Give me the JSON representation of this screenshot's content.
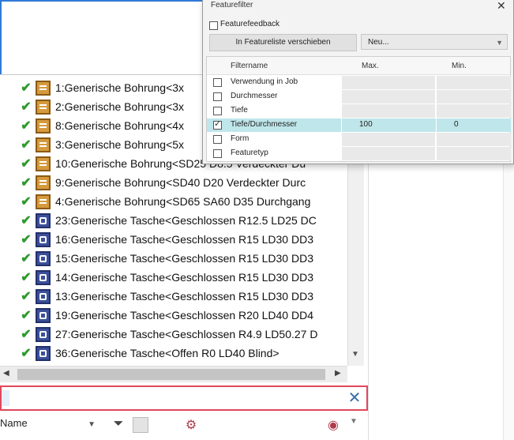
{
  "tree": {
    "items": [
      {
        "label": "1:Generische Bohrung<3x",
        "type": "bore"
      },
      {
        "label": "2:Generische Bohrung<3x",
        "type": "bore"
      },
      {
        "label": "8:Generische Bohrung<4x",
        "type": "bore"
      },
      {
        "label": "3:Generische Bohrung<5x",
        "type": "bore"
      },
      {
        "label": "10:Generische Bohrung<SD25 D8.5 Verdeckter Du",
        "type": "bore"
      },
      {
        "label": "9:Generische Bohrung<SD40 D20 Verdeckter Durc",
        "type": "bore"
      },
      {
        "label": "4:Generische Bohrung<SD65 SA60 D35 Durchgang",
        "type": "bore"
      },
      {
        "label": "23:Generische Tasche<Geschlossen R12.5 LD25 DC",
        "type": "pocket"
      },
      {
        "label": "16:Generische Tasche<Geschlossen R15 LD30 DD3",
        "type": "pocket"
      },
      {
        "label": "15:Generische Tasche<Geschlossen R15 LD30 DD3",
        "type": "pocket"
      },
      {
        "label": "14:Generische Tasche<Geschlossen R15 LD30 DD3",
        "type": "pocket"
      },
      {
        "label": "13:Generische Tasche<Geschlossen R15 LD30 DD3",
        "type": "pocket"
      },
      {
        "label": "19:Generische Tasche<Geschlossen R20 LD40 DD4",
        "type": "pocket"
      },
      {
        "label": "27:Generische Tasche<Geschlossen R4.9 LD50.27 D",
        "type": "pocket"
      },
      {
        "label": "36:Generische Tasche<Offen R0 LD40 Blind>",
        "type": "pocket"
      }
    ]
  },
  "filter": {
    "value": "",
    "placeholder": ""
  },
  "bottombar": {
    "sort_label": "Name"
  },
  "popup": {
    "title": "Featurefilter",
    "featurefeedback_label": "Featurefeedback",
    "move_button_label": "In Featureliste verschieben",
    "combo_value": "Neu...",
    "columns": {
      "name": "Filtername",
      "max": "Max.",
      "min": "Min."
    },
    "rows": [
      {
        "label": "Verwendung in Job",
        "checked": false,
        "max": "",
        "min": "",
        "selected": false
      },
      {
        "label": "Durchmesser",
        "checked": false,
        "max": "",
        "min": "",
        "selected": false
      },
      {
        "label": "Tiefe",
        "checked": false,
        "max": "",
        "min": "",
        "selected": false
      },
      {
        "label": "Tiefe/Durchmesser",
        "checked": true,
        "max": "100",
        "min": "0",
        "selected": true
      },
      {
        "label": "Form",
        "checked": false,
        "max": "",
        "min": "",
        "selected": false
      },
      {
        "label": "Featuretyp",
        "checked": false,
        "max": "",
        "min": "",
        "selected": false
      }
    ]
  },
  "colors": {
    "accent_blue": "#2f79d8",
    "filter_border": "#e0475c",
    "selected_row": "#bfe6ea",
    "check_green": "#2e9a2e"
  }
}
